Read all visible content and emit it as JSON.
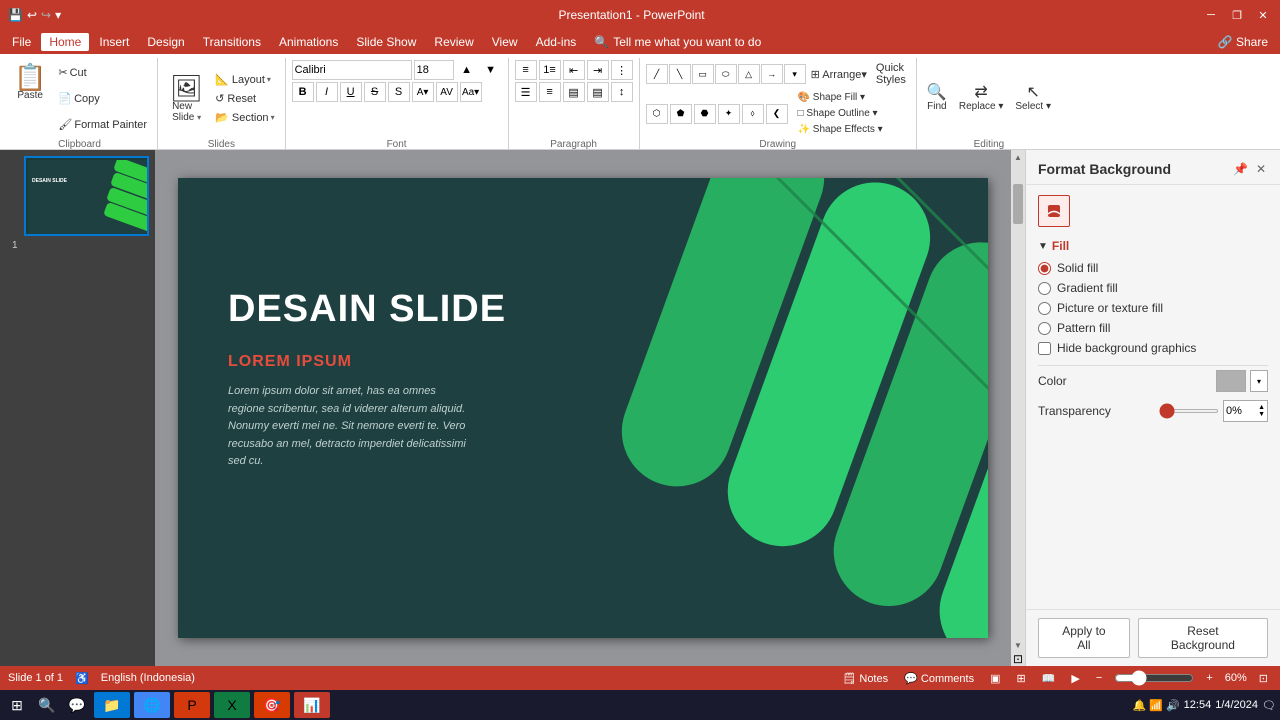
{
  "titlebar": {
    "title": "Presentation1 - PowerPoint",
    "save_icon": "💾",
    "undo_icon": "↩",
    "redo_icon": "↪",
    "customize_icon": "▾",
    "minimize": "─",
    "restore": "❐",
    "close": "✕"
  },
  "menubar": {
    "items": [
      "File",
      "Home",
      "Insert",
      "Design",
      "Transitions",
      "Animations",
      "Slide Show",
      "Review",
      "View",
      "Add-ins",
      "Tell me what you want to do"
    ]
  },
  "ribbon": {
    "clipboard": {
      "label": "Clipboard",
      "paste_label": "Paste",
      "cut_label": "Cut",
      "copy_label": "Copy",
      "format_painter_label": "Format Painter"
    },
    "slides": {
      "label": "Slides",
      "new_slide_label": "New Slide",
      "layout_label": "Layout",
      "reset_label": "Reset",
      "section_label": "Section"
    },
    "font": {
      "label": "Font",
      "font_name": "Calibri",
      "font_size": "18",
      "bold": "B",
      "italic": "I",
      "underline": "U",
      "strikethrough": "S"
    },
    "paragraph": {
      "label": "Paragraph"
    },
    "drawing": {
      "label": "Drawing",
      "shape_fill_label": "Shape Fill",
      "shape_outline_label": "Shape Outline",
      "shape_effects_label": "Shape Effects"
    },
    "editing": {
      "label": "Editing",
      "find_label": "Find",
      "replace_label": "Replace",
      "select_label": "Select"
    }
  },
  "slide": {
    "main_title": "DESAIN SLIDE",
    "subtitle": "LOREM IPSUM",
    "body_text": "Lorem ipsum dolor sit amet, has ea omnes regione scribentur, sea id viderer alterum aliquid. Nonumy everti mei ne. Sit nemore everti te. Vero recusabo an mel, detracto imperdiet delicatissimi sed cu."
  },
  "format_background": {
    "title": "Format Background",
    "fill_section": "Fill",
    "solid_fill": "Solid fill",
    "gradient_fill": "Gradient fill",
    "picture_texture_fill": "Picture or texture fill",
    "pattern_fill": "Pattern fill",
    "hide_background_graphics": "Hide background graphics",
    "color_label": "Color",
    "transparency_label": "Transparency",
    "transparency_value": "0%",
    "apply_to_all_label": "Apply to All",
    "reset_background_label": "Reset Background"
  },
  "statusbar": {
    "slide_info": "Slide 1 of 1",
    "language": "English (Indonesia)",
    "notes_label": "Notes",
    "comments_label": "Comments",
    "zoom_level": "60%"
  },
  "taskbar": {
    "time": "12:54",
    "date": "1/4/2024",
    "apps": [
      "⊞",
      "🔍",
      "💬",
      "📁",
      "🌐",
      "🎯",
      "📊"
    ]
  }
}
